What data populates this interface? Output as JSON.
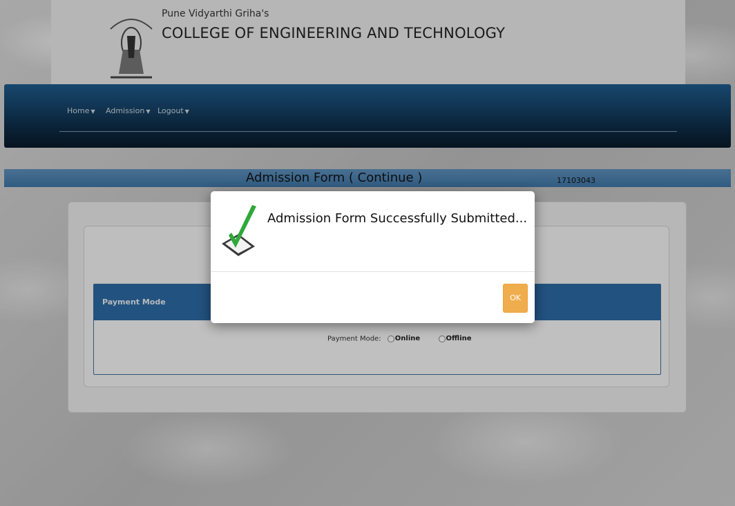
{
  "header": {
    "org": "Pune Vidyarthi Griha's",
    "college": "COLLEGE OF ENGINEERING AND TECHNOLOGY"
  },
  "nav": {
    "items": [
      {
        "label": "Home"
      },
      {
        "label": "Admission"
      },
      {
        "label": "Logout"
      }
    ]
  },
  "form": {
    "title": "Admission Form ( Continue )",
    "id": "17103043"
  },
  "payment": {
    "panel_title": "Payment Mode",
    "field_label": "Payment Mode:",
    "options": [
      {
        "label": "Online"
      },
      {
        "label": "Offline"
      }
    ]
  },
  "modal": {
    "message": "Admission Form Successfully Submitted...",
    "ok_label": "OK"
  },
  "colors": {
    "accent": "#2c6aa3",
    "ok_button": "#f0ad4e",
    "check": "#2fa83a"
  }
}
